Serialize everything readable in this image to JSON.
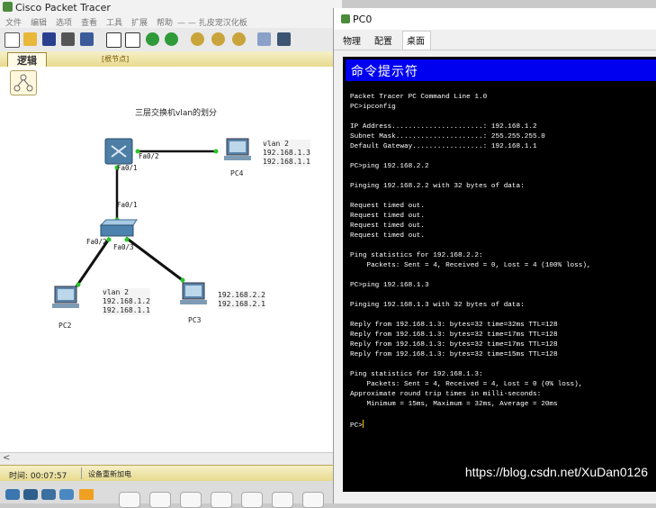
{
  "app": {
    "title": "Cisco Packet Tracer"
  },
  "menu": [
    "文件",
    "编辑",
    "选项",
    "查看",
    "工具",
    "扩展",
    "帮助",
    "— — 扎皮宠汉化板"
  ],
  "workspace": {
    "tab": "逻辑",
    "root_label": "[根节点]"
  },
  "diagram": {
    "title": "三层交换机vlan的划分",
    "multilayer_switch": {
      "name": "",
      "ports": {
        "pc4": "Fa0/2",
        "down": "Fa0/1"
      }
    },
    "switch": {
      "ports": {
        "up": "Fa0/1",
        "pc2": "Fa0/2",
        "pc3": "Fa0/3"
      }
    },
    "pcs": [
      {
        "name": "PC4",
        "info": "vlan 2\n192.168.1.3\n192.168.1.1"
      },
      {
        "name": "PC2",
        "info": "vlan 2\n192.168.1.2\n192.168.1.1"
      },
      {
        "name": "PC3",
        "info": "192.168.2.2\n192.168.2.1"
      }
    ]
  },
  "status": {
    "time": "时间: 00:07:57",
    "message": "设备重新加电"
  },
  "pc_window": {
    "title": "PC0",
    "tabs": [
      "物理",
      "配置",
      "桌面"
    ],
    "active_tab": "桌面",
    "cmd_title": "命令提示符",
    "lines": [
      "Packet Tracer PC Command Line 1.0",
      "PC>ipconfig",
      "",
      "IP Address......................: 192.168.1.2",
      "Subnet Mask.....................: 255.255.255.0",
      "Default Gateway.................: 192.168.1.1",
      "",
      "PC>ping 192.168.2.2",
      "",
      "Pinging 192.168.2.2 with 32 bytes of data:",
      "",
      "Request timed out.",
      "Request timed out.",
      "Request timed out.",
      "Request timed out.",
      "",
      "Ping statistics for 192.168.2.2:",
      "    Packets: Sent = 4, Received = 0, Lost = 4 (100% loss),",
      "",
      "PC>ping 192.168.1.3",
      "",
      "Pinging 192.168.1.3 with 32 bytes of data:",
      "",
      "Reply from 192.168.1.3: bytes=32 time=32ms TTL=128",
      "Reply from 192.168.1.3: bytes=32 time=17ms TTL=128",
      "Reply from 192.168.1.3: bytes=32 time=17ms TTL=128",
      "Reply from 192.168.1.3: bytes=32 time=15ms TTL=128",
      "",
      "Ping statistics for 192.168.1.3:",
      "    Packets: Sent = 4, Received = 4, Lost = 0 (0% loss),",
      "Approximate round trip times in milli-seconds:",
      "    Minimum = 15ms, Maximum = 32ms, Average = 20ms",
      "",
      "PC>"
    ]
  },
  "watermark": "https://blog.csdn.net/XuDan0126"
}
